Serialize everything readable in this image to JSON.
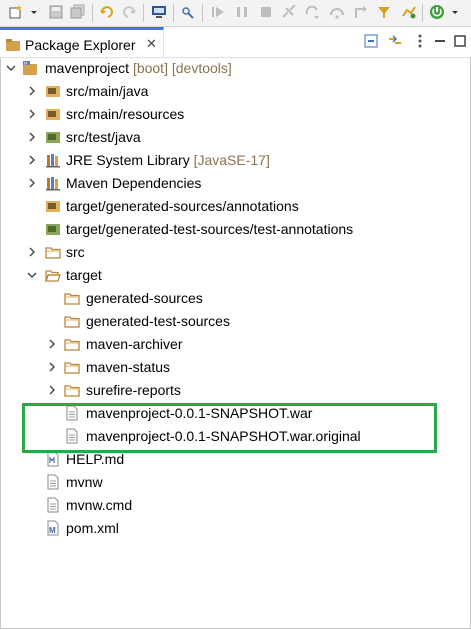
{
  "colors": {
    "highlight": "#29a847",
    "tab_accent": "#2f7be5",
    "decoration": "#8a7350"
  },
  "toolbar": {
    "icons": [
      "new-icon",
      "save-icon",
      "save-all-icon",
      "undo-icon",
      "redo-icon",
      "monitor-icon",
      "debug-icon",
      "resume-icon",
      "suspend-icon",
      "terminate-icon",
      "disconnect-icon",
      "step-into-icon",
      "step-over-icon",
      "step-return-icon",
      "use-step-filters-icon",
      "open-type-icon",
      "spring-boot-icon"
    ]
  },
  "view": {
    "tab_label": "Package Explorer",
    "close_label": "✕"
  },
  "tree": {
    "project": {
      "name": "mavenproject",
      "decoration": "[boot] [devtools]"
    },
    "items": [
      {
        "label": "src/main/java"
      },
      {
        "label": "src/main/resources"
      },
      {
        "label": "src/test/java"
      },
      {
        "label": "JRE System Library",
        "decoration": "[JavaSE-17]"
      },
      {
        "label": "Maven Dependencies"
      },
      {
        "label": "target/generated-sources/annotations"
      },
      {
        "label": "target/generated-test-sources/test-annotations"
      },
      {
        "label": "src"
      },
      {
        "label": "target"
      },
      {
        "label": "generated-sources"
      },
      {
        "label": "generated-test-sources"
      },
      {
        "label": "maven-archiver"
      },
      {
        "label": "maven-status"
      },
      {
        "label": "surefire-reports"
      },
      {
        "label": "mavenproject-0.0.1-SNAPSHOT.war"
      },
      {
        "label": "mavenproject-0.0.1-SNAPSHOT.war.original"
      },
      {
        "label": "HELP.md"
      },
      {
        "label": "mvnw"
      },
      {
        "label": "mvnw.cmd"
      },
      {
        "label": "pom.xml"
      }
    ]
  }
}
